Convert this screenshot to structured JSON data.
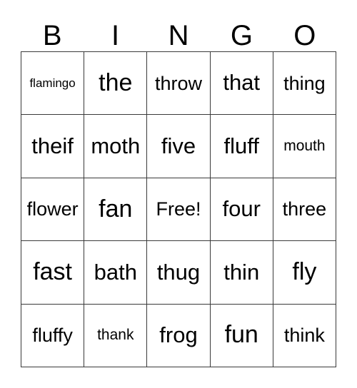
{
  "card": {
    "title": "BINGO",
    "header_letters": [
      "B",
      "I",
      "N",
      "G",
      "O"
    ],
    "free_space_label": "Free!",
    "grid_line_color": "#3a3a3a",
    "text_color": "#000000",
    "background_color": "#ffffff",
    "rows": 5,
    "columns": 5,
    "cells": [
      [
        {
          "text": "flamingo",
          "size": "xs"
        },
        {
          "text": "the",
          "size": "xl"
        },
        {
          "text": "throw",
          "size": "md"
        },
        {
          "text": "that",
          "size": "lg"
        },
        {
          "text": "thing",
          "size": "md"
        }
      ],
      [
        {
          "text": "theif",
          "size": "lg"
        },
        {
          "text": "moth",
          "size": "lg"
        },
        {
          "text": "five",
          "size": "lg"
        },
        {
          "text": "fluff",
          "size": "lg"
        },
        {
          "text": "mouth",
          "size": "sm"
        }
      ],
      [
        {
          "text": "flower",
          "size": "md"
        },
        {
          "text": "fan",
          "size": "xl"
        },
        {
          "text": "Free!",
          "size": "md"
        },
        {
          "text": "four",
          "size": "lg"
        },
        {
          "text": "three",
          "size": "md"
        }
      ],
      [
        {
          "text": "fast",
          "size": "xl"
        },
        {
          "text": "bath",
          "size": "lg"
        },
        {
          "text": "thug",
          "size": "lg"
        },
        {
          "text": "thin",
          "size": "lg"
        },
        {
          "text": "fly",
          "size": "xl"
        }
      ],
      [
        {
          "text": "fluffy",
          "size": "md"
        },
        {
          "text": "thank",
          "size": "sm"
        },
        {
          "text": "frog",
          "size": "lg"
        },
        {
          "text": "fun",
          "size": "xl"
        },
        {
          "text": "think",
          "size": "md"
        }
      ]
    ]
  }
}
